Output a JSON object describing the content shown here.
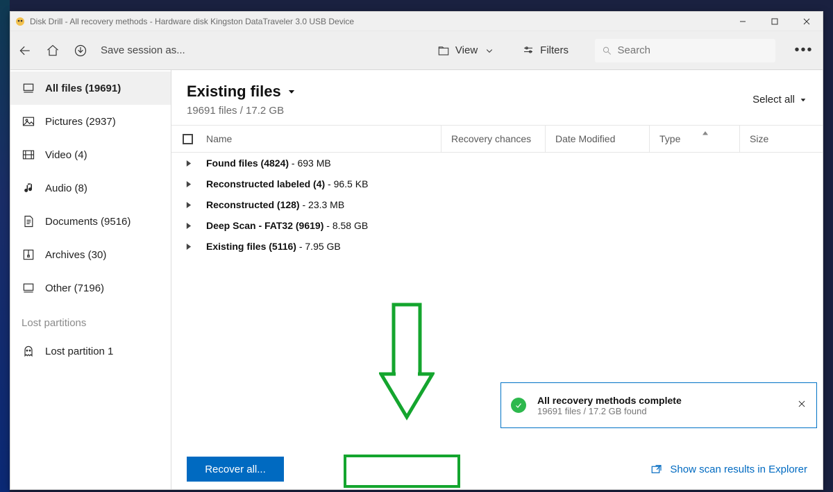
{
  "window": {
    "title": "Disk Drill - All recovery methods - Hardware disk Kingston DataTraveler 3.0 USB Device"
  },
  "toolbar": {
    "save_session": "Save session as...",
    "view": "View",
    "filters": "Filters",
    "search_placeholder": "Search"
  },
  "sidebar": {
    "items": [
      {
        "label": "All files (19691)"
      },
      {
        "label": "Pictures (2937)"
      },
      {
        "label": "Video (4)"
      },
      {
        "label": "Audio (8)"
      },
      {
        "label": "Documents (9516)"
      },
      {
        "label": "Archives (30)"
      },
      {
        "label": "Other (7196)"
      }
    ],
    "lost_heading": "Lost partitions",
    "lost_items": [
      {
        "label": "Lost partition 1"
      }
    ]
  },
  "main": {
    "title": "Existing files",
    "subtitle": "19691 files / 17.2 GB",
    "select_all": "Select all",
    "columns": {
      "name": "Name",
      "recovery": "Recovery chances",
      "date": "Date Modified",
      "type": "Type",
      "size": "Size"
    },
    "rows": [
      {
        "bold": "Found files (4824)",
        "rest": " - 693 MB"
      },
      {
        "bold": "Reconstructed labeled (4)",
        "rest": " - 96.5 KB"
      },
      {
        "bold": "Reconstructed (128)",
        "rest": " - 23.3 MB"
      },
      {
        "bold": "Deep Scan - FAT32 (9619)",
        "rest": " - 8.58 GB"
      },
      {
        "bold": "Existing files (5116)",
        "rest": " - 7.95 GB"
      }
    ]
  },
  "status": {
    "title": "All recovery methods complete",
    "detail": "19691 files / 17.2 GB found"
  },
  "bottom": {
    "recover": "Recover all...",
    "explorer": "Show scan results in Explorer"
  }
}
